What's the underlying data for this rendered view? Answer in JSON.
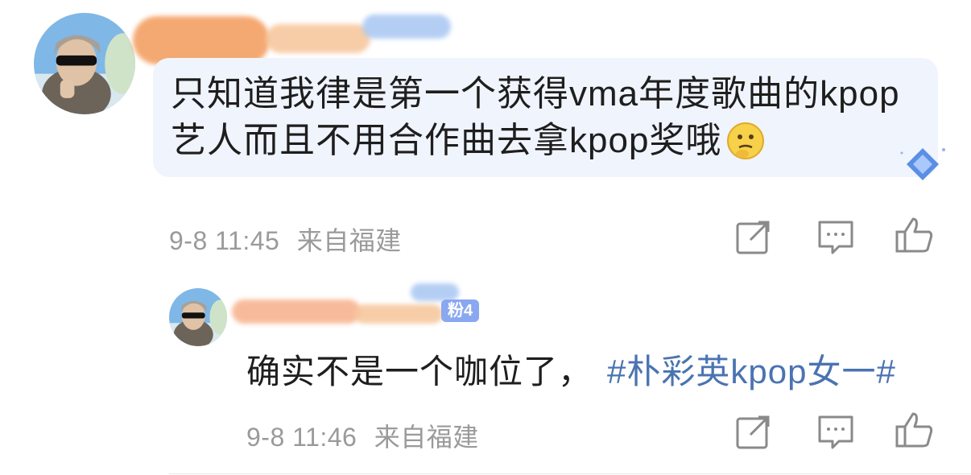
{
  "comment": {
    "text_line1": "只知道我律是第一个获得vma年度歌曲的kpop",
    "text_line2": "艺人而且不用合作曲去拿kpop奖哦",
    "emoji": "thinking-face-icon",
    "date": "9-8 11:45",
    "location": "来自福建"
  },
  "reply": {
    "fan_badge": "粉4",
    "text": "确实不是一个咖位了，",
    "hashtag": "#朴彩英kpop女一#",
    "date": "9-8 11:46",
    "location": "来自福建"
  },
  "icons": {
    "share": "share-icon",
    "comment": "comment-icon",
    "like": "like-icon"
  },
  "colors": {
    "hashtag": "#4a73b1",
    "bubble": "#f0f4fd",
    "meta": "#9a9a9a",
    "badge": "#8aa8f0"
  }
}
